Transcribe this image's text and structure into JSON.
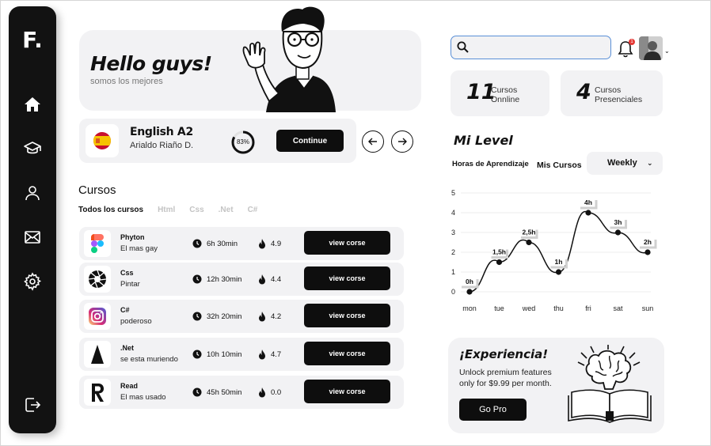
{
  "sidebar": {
    "logo": "F.",
    "items": [
      {
        "icon": "home-icon"
      },
      {
        "icon": "graduation-cap-icon"
      },
      {
        "icon": "user-icon"
      },
      {
        "icon": "mail-icon"
      },
      {
        "icon": "gear-icon"
      },
      {
        "icon": "logout-icon"
      }
    ]
  },
  "hero": {
    "title": "Hello guys!",
    "subtitle": "somos los mejores"
  },
  "lesson": {
    "title": "English A2",
    "teacher": "Arialdo Riaño D.",
    "progress_label": "83%",
    "progress": 0.83,
    "continue_label": "Continue"
  },
  "courses": {
    "title": "Cursos",
    "filters": [
      "Todos los cursos",
      "Html",
      "Css",
      ".Net",
      "C#"
    ],
    "view_label": "view corse",
    "rows": [
      {
        "name": "Phyton",
        "desc": "El mas gay",
        "time": "6h 30min",
        "rating": "4.9",
        "icon": "figma-icon"
      },
      {
        "name": "Css",
        "desc": "Pintar",
        "time": "12h 30min",
        "rating": "4.4",
        "icon": "aperture-icon"
      },
      {
        "name": "C#",
        "desc": "poderoso",
        "time": "32h 20min",
        "rating": "4.2",
        "icon": "instagram-icon"
      },
      {
        "name": ".Net",
        "desc": "se esta muriendo",
        "time": "10h 10min",
        "rating": "4.7",
        "icon": "triangle-icon"
      },
      {
        "name": "Read",
        "desc": "El mas usado",
        "time": "45h 50min",
        "rating": "0.0",
        "icon": "letter-r-icon"
      }
    ]
  },
  "search": {
    "placeholder": "",
    "value": ""
  },
  "notifications": {
    "count": "1"
  },
  "stats": [
    {
      "number": "11",
      "line1": "Cursos",
      "line2": "Onnline"
    },
    {
      "number": "4",
      "line1": "Cursos",
      "line2": "Presenciales"
    }
  ],
  "level": {
    "title": "Mi Level",
    "tab_hours": "Horas de Aprendizaje",
    "tab_courses": "Mis Cursos",
    "period": "Weekly"
  },
  "chart_data": {
    "type": "line",
    "categories": [
      "mon",
      "tue",
      "wed",
      "thu",
      "fri",
      "sat",
      "sun"
    ],
    "values": [
      0,
      1.5,
      2.5,
      1,
      4,
      3,
      2
    ],
    "data_labels": [
      "0h",
      "1,5h",
      "2,5h",
      "1h",
      "4h",
      "3h",
      "2h"
    ],
    "yticks": [
      0,
      1,
      2,
      3,
      4,
      5
    ],
    "ylim": [
      0,
      5
    ],
    "grid": true,
    "line_color": "#111111"
  },
  "promo": {
    "title": "¡Experiencia!",
    "text": "Unlock premium features only for $9.99 per month.",
    "button_label": "Go Pro"
  }
}
